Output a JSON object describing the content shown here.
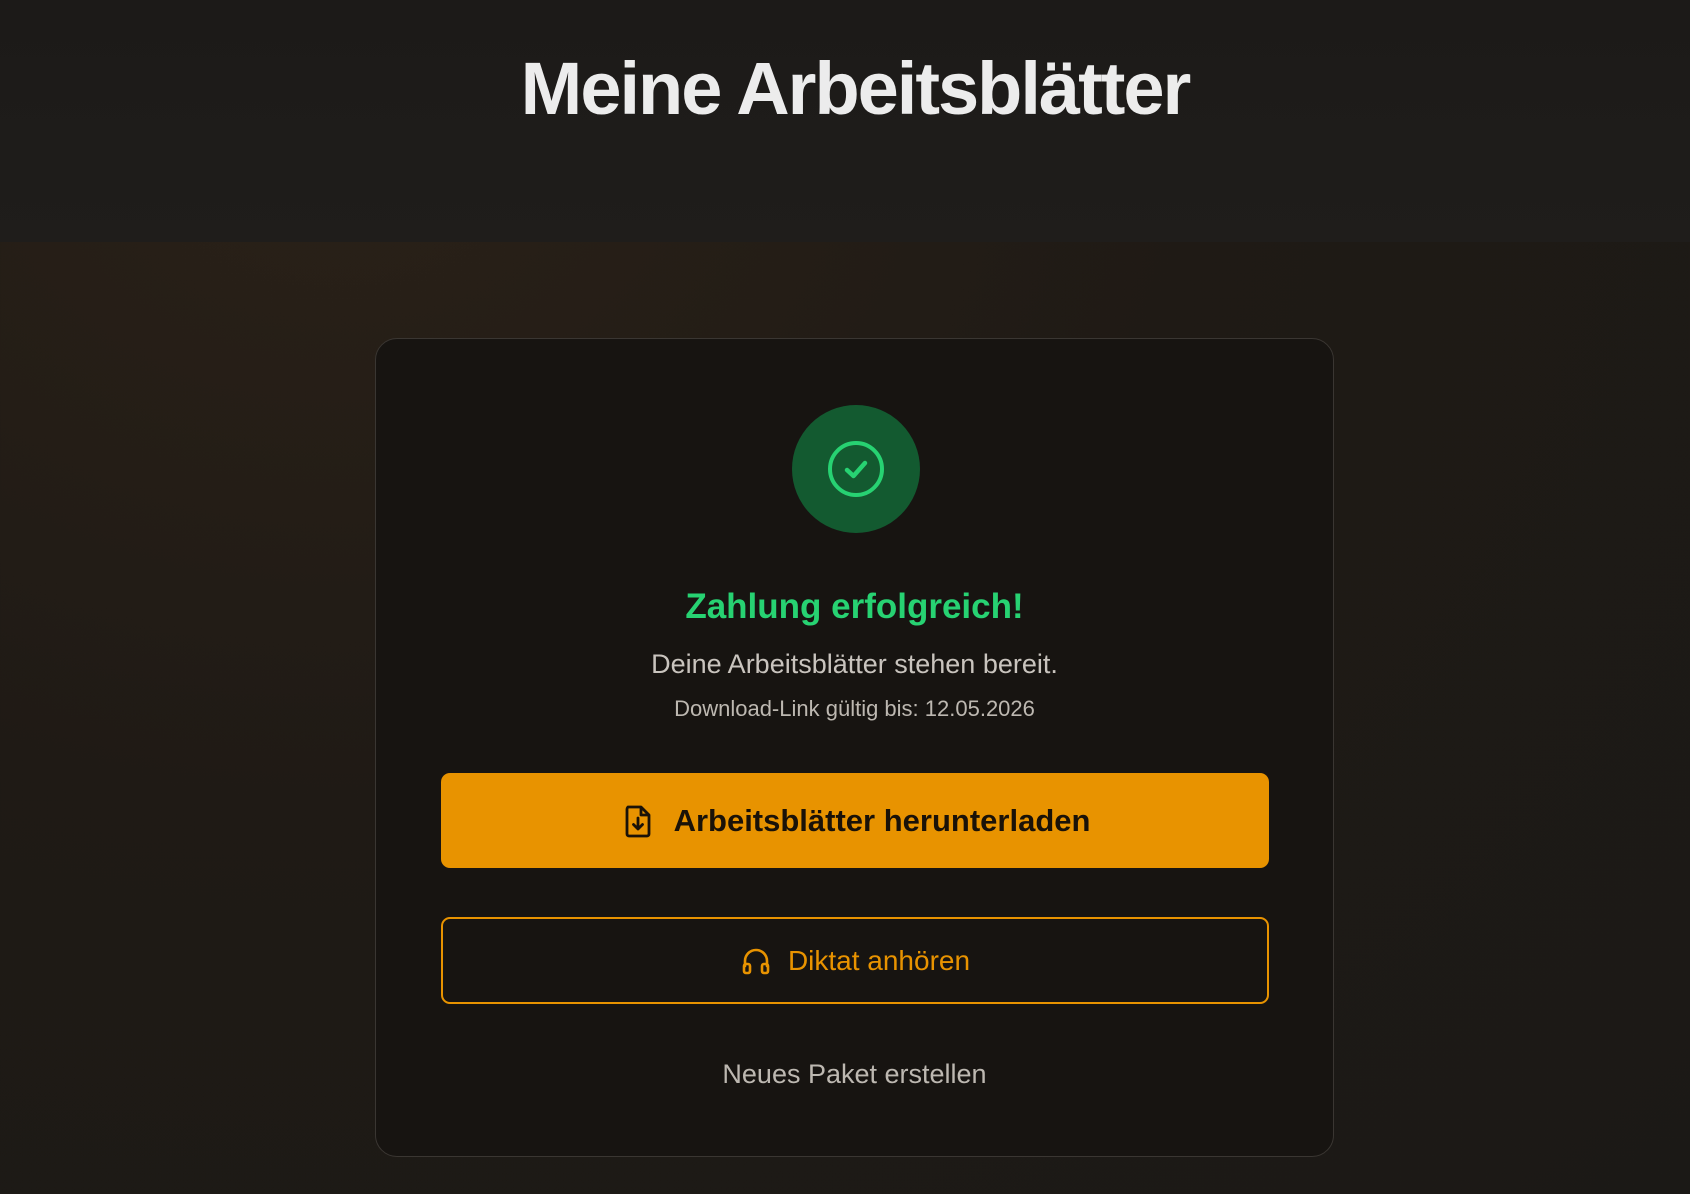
{
  "header": {
    "title": "Meine Arbeitsblätter"
  },
  "card": {
    "icon": "check-circle-icon",
    "success_title": "Zahlung erfolgreich!",
    "success_subtitle": "Deine Arbeitsblätter stehen bereit.",
    "validity_text": "Download-Link gültig bis: 12.05.2026",
    "download_button": {
      "label": "Arbeitsblätter herunterladen",
      "icon": "file-download-icon"
    },
    "listen_button": {
      "label": "Diktat anhören",
      "icon": "headphones-icon"
    },
    "new_package_link": "Neues Paket erstellen"
  },
  "colors": {
    "accent": "#e89300",
    "success": "#27d272",
    "success_bg": "#135a30",
    "background": "#1b1916",
    "card_bg": "#171411"
  }
}
